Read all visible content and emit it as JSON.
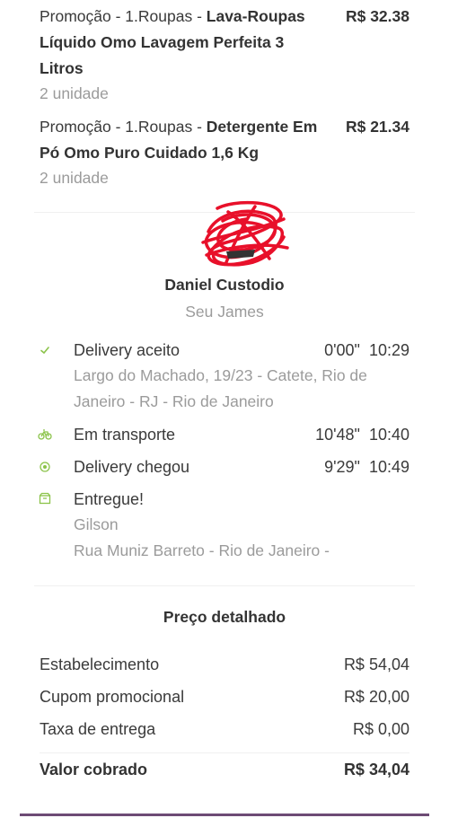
{
  "items": [
    {
      "prefix": "Promoção - 1.Roupas - ",
      "name": "Lava-Roupas Líquido Omo Lavagem Perfeita 3 Litros",
      "price": "R$ 32.38",
      "qty": "2 unidade"
    },
    {
      "prefix": "Promoção - 1.Roupas - ",
      "name": "Detergente Em Pó Omo Puro Cuidado 1,6 Kg",
      "price": "R$ 21.34",
      "qty": "2 unidade"
    }
  ],
  "courier": {
    "name": "Daniel Custodio",
    "subtitle": "Seu James"
  },
  "timeline": [
    {
      "icon": "check-icon",
      "title": "Delivery aceito",
      "duration": "0'00\"",
      "time": "10:29",
      "detail": "Largo do Machado, 19/23 - Catete, Rio de Janeiro - RJ - Rio de Janeiro"
    },
    {
      "icon": "bicycle-icon",
      "title": "Em transporte",
      "duration": "10'48\"",
      "time": "10:40"
    },
    {
      "icon": "location-target-icon",
      "title": "Delivery chegou",
      "duration": "9'29\"",
      "time": "10:49"
    },
    {
      "icon": "package-icon",
      "title": "Entregue!",
      "recipient": "Gilson",
      "address": "Rua Muniz Barreto - Rio de Janeiro -"
    }
  ],
  "price_breakdown": {
    "title": "Preço detalhado",
    "rows": [
      {
        "label": "Estabelecimento",
        "value": "R$ 54,04"
      },
      {
        "label": "Cupom promocional",
        "value": "R$ 20,00"
      },
      {
        "label": "Taxa de entrega",
        "value": "R$ 0,00"
      }
    ],
    "total": {
      "label": "Valor cobrado",
      "value": "R$ 34,04"
    }
  },
  "colors": {
    "accent_green": "#8bc34a",
    "brand_purple": "#6d4b75",
    "scribble_red": "#e8102a",
    "muted_text": "#9b9b9b"
  }
}
